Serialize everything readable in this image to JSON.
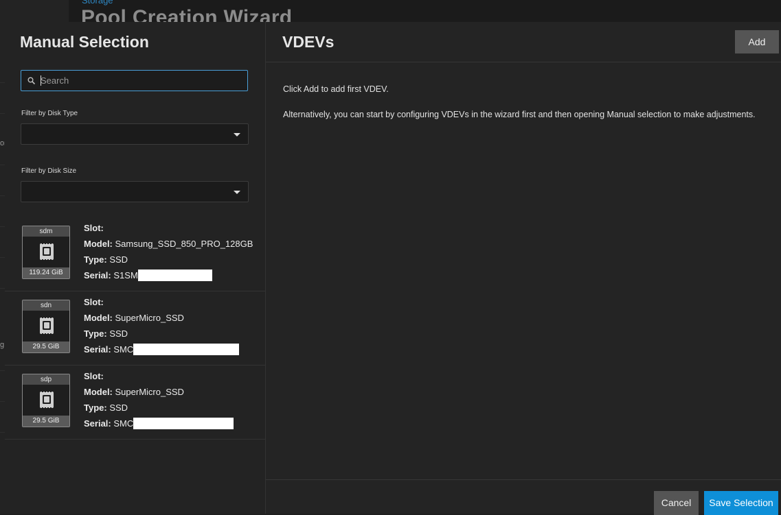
{
  "background": {
    "breadcrumb": "Storage",
    "page_title": "Pool Creation Wizard",
    "sidebar_fragments": [
      "or",
      "g"
    ]
  },
  "left_panel": {
    "title": "Manual Selection",
    "search": {
      "placeholder": "Search",
      "value": ""
    },
    "filter_type": {
      "label": "Filter by Disk Type",
      "value": ""
    },
    "filter_size": {
      "label": "Filter by Disk Size",
      "value": ""
    },
    "disks": [
      {
        "name": "sdm",
        "size": "119.24 GiB",
        "slot_key": "Slot:",
        "slot": "",
        "model_key": "Model:",
        "model": "Samsung_SSD_850_PRO_128GB",
        "type_key": "Type:",
        "type": "SSD",
        "serial_key": "Serial:",
        "serial": "S1SM"
      },
      {
        "name": "sdn",
        "size": "29.5 GiB",
        "slot_key": "Slot:",
        "slot": "",
        "model_key": "Model:",
        "model": "SuperMicro_SSD",
        "type_key": "Type:",
        "type": "SSD",
        "serial_key": "Serial:",
        "serial": "SMC"
      },
      {
        "name": "sdp",
        "size": "29.5 GiB",
        "slot_key": "Slot:",
        "slot": "",
        "model_key": "Model:",
        "model": "SuperMicro_SSD",
        "type_key": "Type:",
        "type": "SSD",
        "serial_key": "Serial:",
        "serial": "SMC"
      }
    ]
  },
  "right_panel": {
    "title": "VDEVs",
    "add_label": "Add",
    "message1": "Click Add to add first VDEV.",
    "message2": "Alternatively, you can start by configuring VDEVs in the wizard first and then opening Manual selection to make adjustments."
  },
  "footer": {
    "cancel_label": "Cancel",
    "save_label": "Save Selection"
  },
  "colors": {
    "accent": "#0e8fd8",
    "focus_border": "#4a9fd8",
    "button_gray": "#555555",
    "panel_bg": "#232323"
  }
}
